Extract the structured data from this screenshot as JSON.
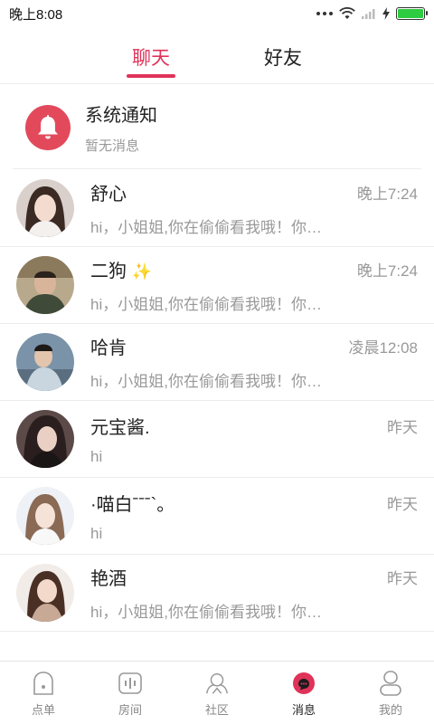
{
  "status_bar": {
    "time": "晚上8:08",
    "battery_level": 1.0
  },
  "tabs": [
    {
      "label": "聊天",
      "active": true
    },
    {
      "label": "好友",
      "active": false
    }
  ],
  "system_notice": {
    "title": "系统通知",
    "subtitle": "暂无消息",
    "icon": "bell-icon"
  },
  "chats": [
    {
      "name": "舒心",
      "time": "晚上7:24",
      "message": "hi，小姐姐,你在偷偷看我哦！你想和我聊天吗"
    },
    {
      "name": "二狗",
      "time": "晚上7:24",
      "message": "hi，小姐姐,你在偷偷看我哦！你想和我聊天吗"
    },
    {
      "name": "哈肯",
      "time": "凌晨12:08",
      "message": "hi，小姐姐,你在偷偷看我哦！你想和我聊天吗"
    },
    {
      "name": "元宝酱.",
      "time": "昨天",
      "message": "hi"
    },
    {
      "name": "·喵白ˉˉˉ`。",
      "time": "昨天",
      "message": "hi"
    },
    {
      "name": "艳酒",
      "time": "昨天",
      "message": "hi，小姐姐,你在偷偷看我哦！你想和我聊天吗"
    }
  ],
  "bottom_nav": [
    {
      "label": "点单",
      "icon": "order-icon",
      "active": false
    },
    {
      "label": "房间",
      "icon": "room-icon",
      "active": false
    },
    {
      "label": "社区",
      "icon": "community-icon",
      "active": false
    },
    {
      "label": "消息",
      "icon": "message-icon",
      "active": true
    },
    {
      "label": "我的",
      "icon": "profile-icon",
      "active": false
    }
  ],
  "colors": {
    "accent": "#e0335a",
    "notice_red": "#e24a5c",
    "muted": "#999999"
  }
}
